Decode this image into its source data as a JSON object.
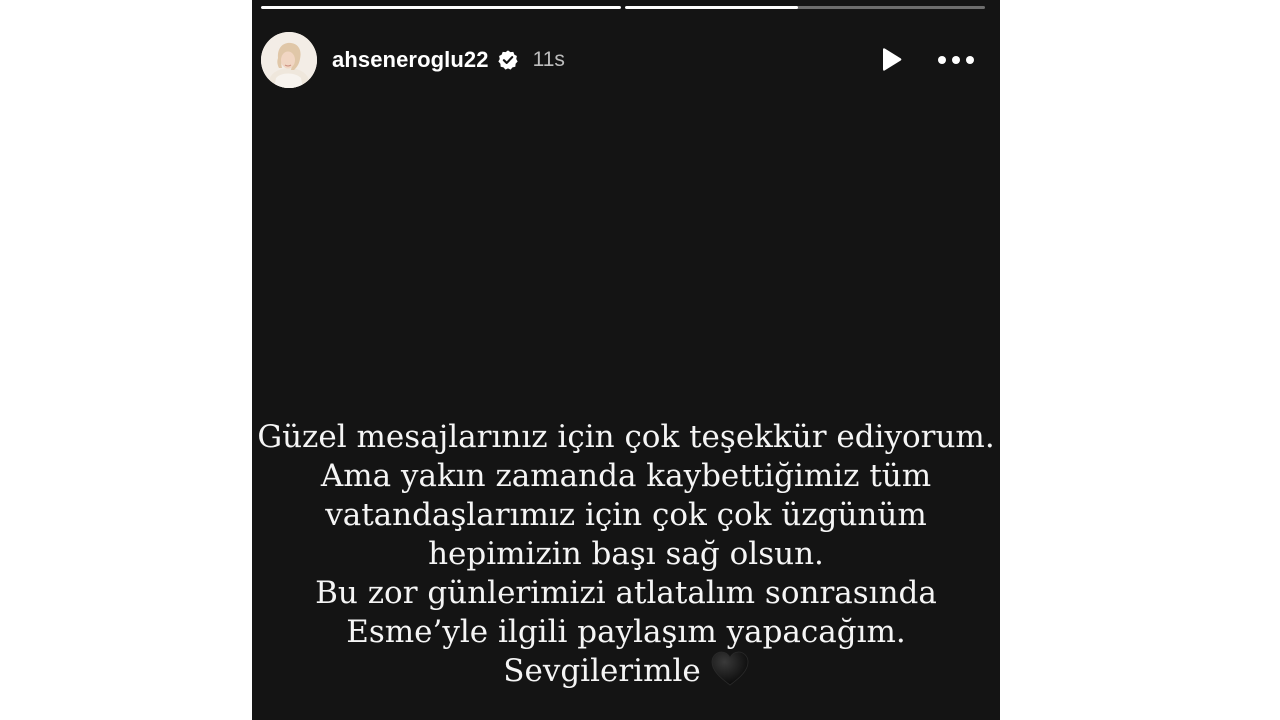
{
  "story": {
    "progress": [
      1.0,
      0.48
    ],
    "author": {
      "username": "ahseneroglu22",
      "verified": true,
      "time_ago": "11s"
    },
    "controls": {
      "play_icon": "play-icon",
      "more_icon": "more-icon"
    },
    "message": {
      "lines": [
        "Güzel mesajlarınız için çok teşekkür ediyorum.",
        "Ama yakın zamanda kaybettiğimiz tüm",
        "vatandaşlarımız için çok çok üzgünüm",
        "hepimizin başı sağ olsun.",
        "Bu zor günlerimizi atlatalım sonrasında",
        "Esme’yle ilgili paylaşım yapacağım.",
        "Sevgilerimle"
      ],
      "emoji": "black-heart"
    },
    "colors": {
      "background": "#141414",
      "text": "#f5f5f5"
    }
  }
}
